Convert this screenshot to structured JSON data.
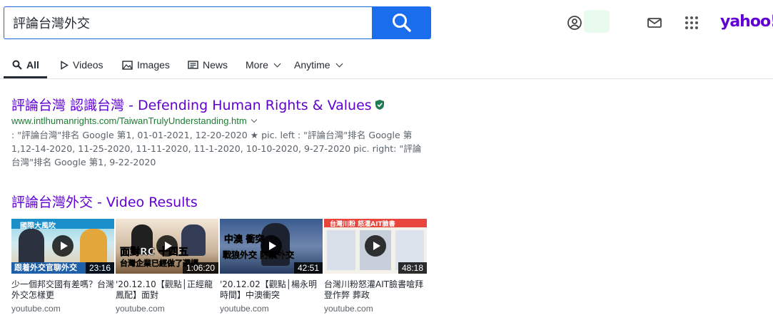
{
  "search": {
    "query": "評論台灣外交"
  },
  "brand": {
    "logo_text": "yahoo!",
    "accent": "#6001d2",
    "button_color": "#1a6eee"
  },
  "tabs": [
    {
      "label": "All",
      "icon": "search-icon",
      "active": true
    },
    {
      "label": "Videos",
      "icon": "play-icon"
    },
    {
      "label": "Images",
      "icon": "image-icon"
    },
    {
      "label": "News",
      "icon": "news-icon"
    },
    {
      "label": "More",
      "icon": "chevron-down-icon"
    },
    {
      "label": "Anytime",
      "icon": "chevron-down-icon"
    }
  ],
  "result": {
    "title": "評論台灣 認識台灣 - Defending Human Rights & Values",
    "url": "www.intlhumanrights.com/TaiwanTrulyUnderstanding.htm",
    "snippet": ": \"評論台灣\"排名 Google 第1, 01-01-2021, 12-20-2020 ★ pic. left : \"評論台灣\"排名 Google 第1,12-14-2020, 11-25-2020, 11-11-2020, 11-1-2020, 10-10-2020, 9-27-2020 pic. right: \"評論台灣\"排名 Google 第1, 9-22-2020"
  },
  "video_results": {
    "title": "評論台灣外交 - Video Results",
    "items": [
      {
        "duration": "23:16",
        "caption": "少一個邦交國有差嗎？台灣外交怎樣更",
        "source": "youtube.com",
        "thumb_text": "國際大風吹",
        "thumb_banner": "跟着外交官聊外交"
      },
      {
        "duration": "1:06:20",
        "caption": "'20.12.10【觀點│正經龍鳳配】面對",
        "source": "youtube.com",
        "thumb_text": "面對RC 十四五",
        "thumb_banner": "台灣企業已經做了選擇"
      },
      {
        "duration": "42:51",
        "caption": "'20.12.02【觀點│楊永明時間】中澳衝突",
        "source": "youtube.com",
        "thumb_text": "中澳 衝突",
        "thumb_banner": "戰狼外交 防禦外交"
      },
      {
        "duration": "48:18",
        "caption": "台灣川粉怒灌AIT臉書嗆拜登作弊 葬政",
        "source": "youtube.com",
        "thumb_text": "台灣川粉 怒灌AIT臉書",
        "thumb_banner": ""
      }
    ]
  }
}
